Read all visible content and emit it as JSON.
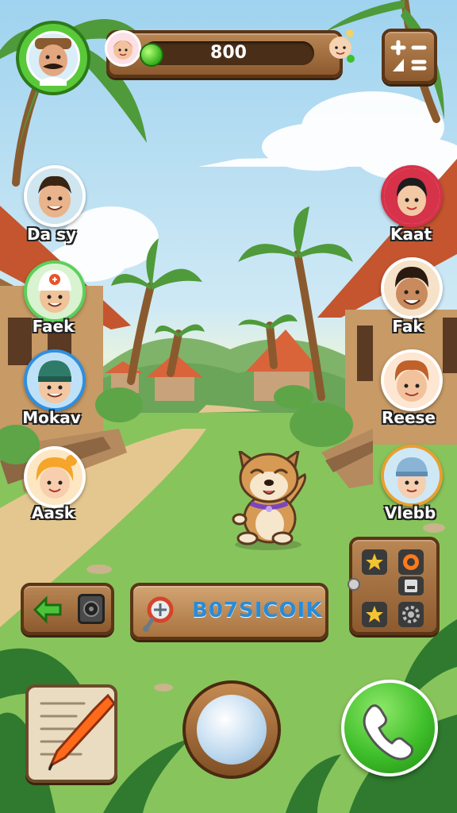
{
  "hud": {
    "coins": "800",
    "player_avatar": "mustache-man-avatar",
    "menu_icon": "calculator-icon"
  },
  "npcs": [
    {
      "name": "Da sy",
      "side": "left",
      "hair": "#3a2412",
      "skin": "#e9b38c",
      "ring": "#ffffff",
      "bg": "#cfe5f0"
    },
    {
      "name": "Faek",
      "side": "left",
      "hair": "#ffffff",
      "skin": "#f0c39a",
      "ring": "#5ad15a",
      "bg": "#d9f2d0"
    },
    {
      "name": "Mokav",
      "side": "left",
      "hair": "#2f7b6a",
      "skin": "#f2c7a2",
      "ring": "#2f8fe0",
      "bg": "#bfe1f7"
    },
    {
      "name": "Aask",
      "side": "left",
      "hair": "#f4a52a",
      "skin": "#f7cfae",
      "ring": "#ffffff",
      "bg": "#fde7c2"
    },
    {
      "name": "Kaat",
      "side": "right",
      "hair": "#1d1d1d",
      "skin": "#f3c8a5",
      "ring": "#d6324a",
      "bg": "#fde0e5"
    },
    {
      "name": "Fak",
      "side": "right",
      "hair": "#2a1a10",
      "skin": "#c98a5e",
      "ring": "#ffffff",
      "bg": "#f6e2c8"
    },
    {
      "name": "Reese",
      "side": "right",
      "hair": "#c0612a",
      "skin": "#f2c29c",
      "ring": "#ffffff",
      "bg": "#fde7d2"
    },
    {
      "name": "Vlebb",
      "side": "right",
      "hair": "#8ab4d6",
      "skin": "#f4cfb0",
      "ring": "#e8a030",
      "bg": "#cfe8f5"
    }
  ],
  "actions": {
    "code_label": "B07SICOIK",
    "left_panel_icons": [
      "green-arrow-icon",
      "speaker-icon"
    ],
    "right_panel_icons": [
      "star-icon",
      "ring-icon",
      "card-icon",
      "star-icon",
      "gear-icon"
    ],
    "bottom": [
      "notepad-pencil-icon",
      "lens-button",
      "phone-icon"
    ]
  },
  "colors": {
    "wood": "#9a6636",
    "wood_dark": "#5b3516",
    "call_green": "#3fbf2a",
    "label_blue": "#2a8bd6"
  }
}
